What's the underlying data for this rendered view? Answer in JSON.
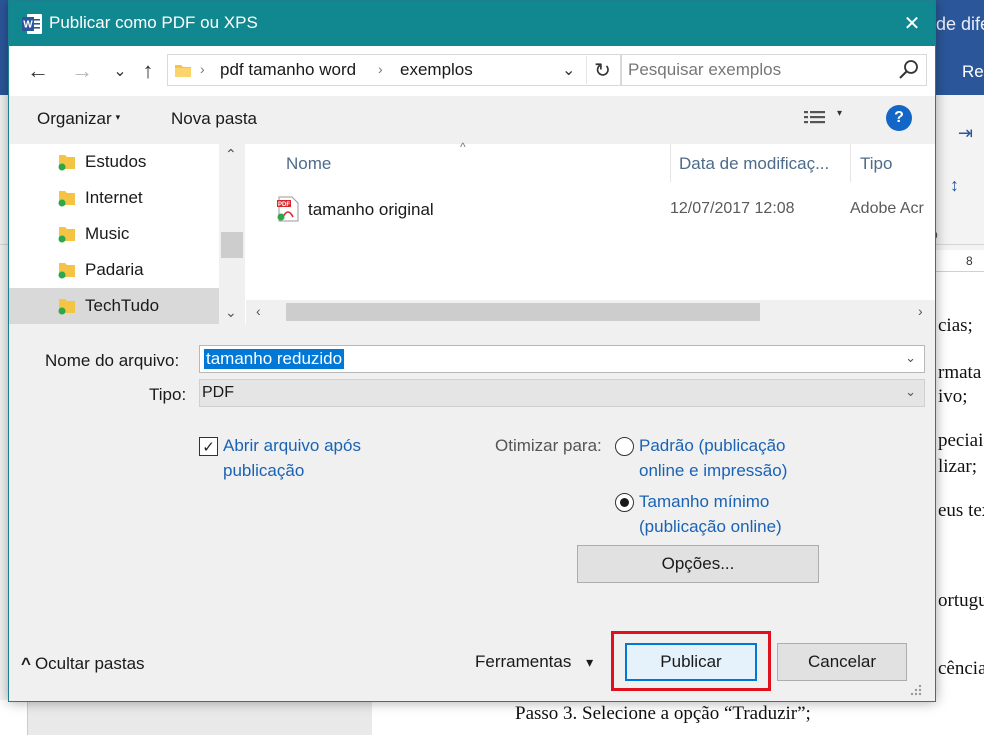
{
  "background": {
    "ribbon_fragment": "de dife",
    "ribbon_tab_fragment": "Re",
    "side_label": "o",
    "ruler_number": "8",
    "document_lines": [
      "cias;",
      "rmata",
      "ivo;",
      "peciais",
      "lizar;",
      "eus tex",
      "ortugu",
      "cência",
      "Passo 3. Selecione a opção “Traduzir”;"
    ]
  },
  "dialog": {
    "title": "Publicar como PDF ou XPS",
    "close_glyph": "✕"
  },
  "nav": {
    "back_glyph": "←",
    "forward_glyph": "→",
    "recent_glyph": "⌄",
    "up_glyph": "↑",
    "breadcrumb": [
      "pdf tamanho word",
      "exemplos"
    ],
    "crumb_sep": "›",
    "dropdown_glyph": "⌄",
    "refresh_glyph": "↻",
    "search_placeholder": "Pesquisar exemplos"
  },
  "toolbar": {
    "organize_label": "Organizar",
    "new_folder_label": "Nova pasta",
    "help_label": "?"
  },
  "navpane": {
    "items": [
      {
        "label": "Estudos"
      },
      {
        "label": "Internet"
      },
      {
        "label": "Music"
      },
      {
        "label": "Padaria"
      },
      {
        "label": "TechTudo"
      }
    ],
    "scroll_up": "⌃",
    "scroll_down": "⌄"
  },
  "files": {
    "columns": [
      "Nome",
      "Data de modificaç...",
      "Tipo"
    ],
    "rows": [
      {
        "name": "tamanho original",
        "date": "12/07/2017 12:08",
        "type": "Adobe Acr"
      }
    ],
    "scroll_left": "‹",
    "scroll_right": "›"
  },
  "form": {
    "filename_label": "Nome do arquivo:",
    "filename_value": "tamanho reduzido",
    "type_label": "Tipo:",
    "type_value": "PDF",
    "open_after_line1": "Abrir arquivo após",
    "open_after_line2": "publicação",
    "open_after_checked": true,
    "check_glyph": "✓",
    "optimize_label": "Otimizar para:",
    "option_standard_line1": "Padrão (publicação",
    "option_standard_line2": "online e impressão)",
    "option_minimum_line1": "Tamanho mínimo",
    "option_minimum_line2": "(publicação online)",
    "selected_option": "Tamanho mínimo",
    "options_button": "Opções..."
  },
  "footer": {
    "hide_folders_label": "Ocultar pastas",
    "hide_glyph": "^",
    "tools_label": "Ferramentas",
    "tools_caret": "▾",
    "publish_label": "Publicar",
    "cancel_label": "Cancelar"
  },
  "colors": {
    "titlebar": "#11878f",
    "link": "#1a63b4",
    "highlight": "#e0101c",
    "word_blue": "#2b579a",
    "selection": "#0078d7"
  }
}
